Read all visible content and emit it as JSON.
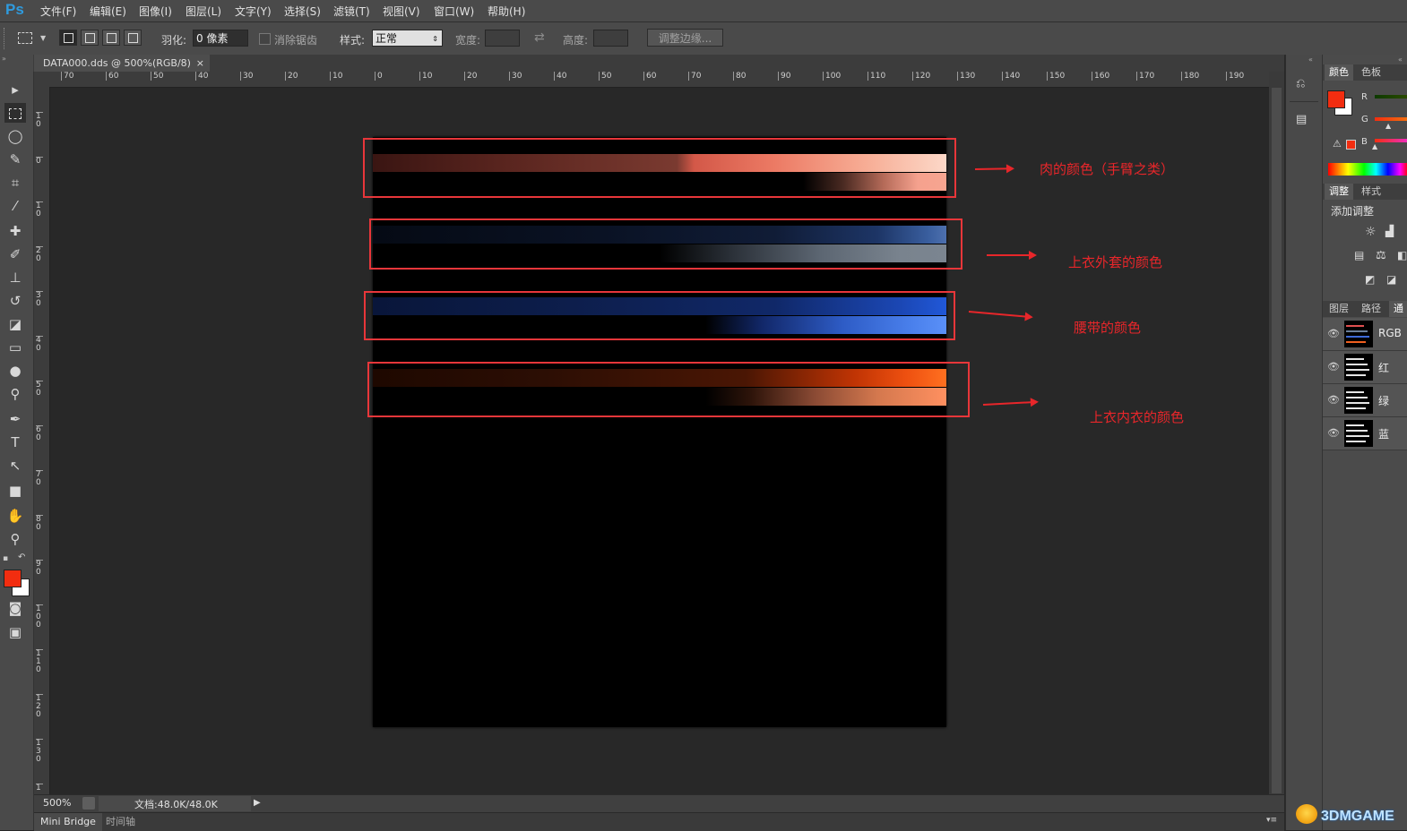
{
  "menu": {
    "logo": "Ps",
    "items": [
      "文件(F)",
      "编辑(E)",
      "图像(I)",
      "图层(L)",
      "文字(Y)",
      "选择(S)",
      "滤镜(T)",
      "视图(V)",
      "窗口(W)",
      "帮助(H)"
    ]
  },
  "options": {
    "feather_label": "羽化:",
    "feather_value": "0 像素",
    "antialias_label": "消除锯齿",
    "style_label": "样式:",
    "style_value": "正常",
    "width_label": "宽度:",
    "height_label": "高度:",
    "refine_edge_label": "调整边缘..."
  },
  "document": {
    "tab_title": "DATA000.dds @ 500%(RGB/8)",
    "close_glyph": "×"
  },
  "ruler": {
    "h_ticks": [
      "70",
      "60",
      "50",
      "40",
      "30",
      "20",
      "10",
      "0",
      "10",
      "20",
      "30",
      "40",
      "50",
      "60",
      "70",
      "80",
      "90",
      "100",
      "110",
      "120",
      "130",
      "140",
      "150",
      "160",
      "170",
      "180",
      "190"
    ],
    "v_ticks": [
      "10",
      "0",
      "10",
      "20",
      "30",
      "40",
      "50",
      "60",
      "70",
      "80",
      "90",
      "100",
      "110",
      "120",
      "130",
      "1"
    ]
  },
  "annotations": [
    {
      "label": "肉的颜色（手臂之类）"
    },
    {
      "label": "上衣外套的颜色"
    },
    {
      "label": "腰带的颜色"
    },
    {
      "label": "上衣内衣的颜色"
    }
  ],
  "status": {
    "zoom": "500%",
    "doc_size": "文档:48.0K/48.0K"
  },
  "bottom_tabs": [
    "Mini Bridge",
    "时间轴"
  ],
  "panels": {
    "color_tabs": [
      "颜色",
      "色板"
    ],
    "channel_letters": [
      "R",
      "G",
      "B"
    ],
    "adjust_tabs": [
      "调整",
      "样式"
    ],
    "add_adjustment": "添加调整",
    "layer_tabs": [
      "图层",
      "路径",
      "通"
    ],
    "channels": [
      "RGB",
      "红",
      "绿",
      "蓝"
    ]
  },
  "colors": {
    "foreground": "#f22d10",
    "background": "#ffffff",
    "annotation": "#e8262a",
    "ps_blue": "#2f9bde"
  },
  "watermark": "3DMGAME"
}
